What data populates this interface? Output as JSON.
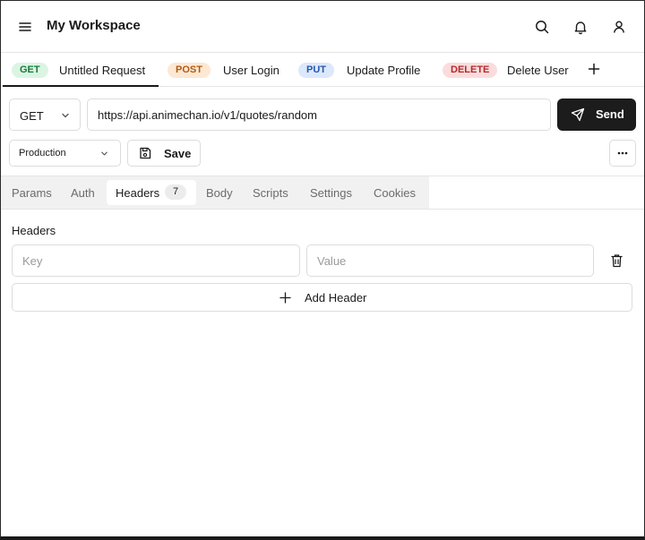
{
  "app": {
    "workspace_title": "My Workspace"
  },
  "topbar_icons": [
    "menu-icon",
    "search-icon",
    "bell-icon",
    "user-icon"
  ],
  "request_tabs": [
    {
      "method": "GET",
      "name": "Untitled Request",
      "active": true
    },
    {
      "method": "POST",
      "name": "User Login",
      "active": false
    },
    {
      "method": "PUT",
      "name": "Update Profile",
      "active": false
    },
    {
      "method": "DELETE",
      "name": "Delete User",
      "active": false
    }
  ],
  "request": {
    "method": "GET",
    "url": "https://api.animechan.io/v1/quotes/random",
    "send_label": "Send"
  },
  "environment": {
    "selected": "Production"
  },
  "save_label": "Save",
  "section_tabs": [
    {
      "label": "Params",
      "active": false
    },
    {
      "label": "Auth",
      "active": false
    },
    {
      "label": "Headers",
      "count": "7",
      "active": true
    },
    {
      "label": "Body",
      "active": false
    },
    {
      "label": "Scripts",
      "active": false
    },
    {
      "label": "Settings",
      "active": false
    },
    {
      "label": "Cookies",
      "active": false
    }
  ],
  "headers": {
    "title": "Headers",
    "key_placeholder": "Key",
    "value_placeholder": "Value",
    "add_label": "Add Header"
  },
  "colors": {
    "get": "#157a3a",
    "post": "#b05a12",
    "put": "#2358b0",
    "delete": "#b22a2a",
    "send_bg": "#1c1c1c"
  }
}
